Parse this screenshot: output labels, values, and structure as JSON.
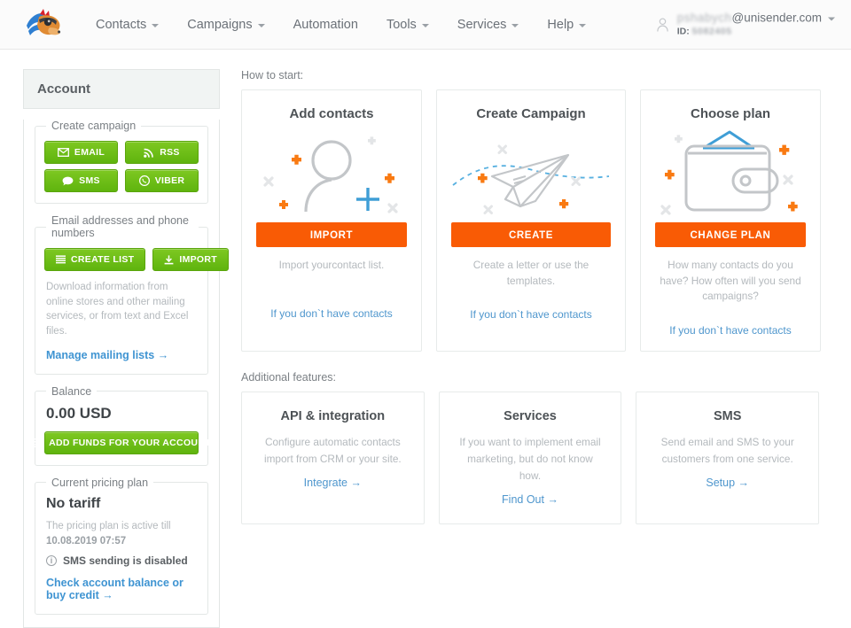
{
  "header": {
    "logo_alt": "unisender-dog-logo",
    "nav": [
      {
        "label": "Contacts",
        "caret": true
      },
      {
        "label": "Campaigns",
        "caret": true
      },
      {
        "label": "Automation",
        "caret": false
      },
      {
        "label": "Tools",
        "caret": true
      },
      {
        "label": "Services",
        "caret": true
      },
      {
        "label": "Help",
        "caret": true
      }
    ],
    "account": {
      "username_redacted": "pshabych",
      "email_domain": "@unisender.com",
      "id_label": "ID:",
      "id_redacted": "5082405"
    }
  },
  "sidebar": {
    "title": "Account",
    "create_campaign": {
      "legend": "Create campaign",
      "buttons": [
        {
          "label": "EMAIL",
          "icon": "envelope-icon"
        },
        {
          "label": "RSS",
          "icon": "rss-icon"
        },
        {
          "label": "SMS",
          "icon": "chat-bubble-icon"
        },
        {
          "label": "VIBER",
          "icon": "viber-icon"
        }
      ]
    },
    "addresses": {
      "legend": "Email addresses and phone numbers",
      "buttons": [
        {
          "label": "CREATE LIST",
          "icon": "list-icon"
        },
        {
          "label": "IMPORT",
          "icon": "download-icon"
        }
      ],
      "hint": "Download information from online stores and other mailing services, or from text and Excel files.",
      "link": "Manage mailing lists  →"
    },
    "balance": {
      "legend": "Balance",
      "value": "0.00 USD",
      "button": "ADD FUNDS FOR YOUR ACCOUNT",
      "button_icon": "credit-card-icon"
    },
    "pricing": {
      "legend": "Current pricing plan",
      "plan_name": "No tariff",
      "note_prefix": "The pricing plan is active till ",
      "note_date": "10.08.2019 07:57",
      "sms_status": "SMS sending is disabled",
      "link": "Check account balance or buy credit →"
    }
  },
  "main": {
    "how_to_start_label": "How to start:",
    "start_cards": [
      {
        "title": "Add contacts",
        "illustration": "person-plus-illustration",
        "button": "IMPORT",
        "desc": "Import yourcontact list.",
        "link": "If you don`t have contacts"
      },
      {
        "title": "Create Campaign",
        "illustration": "paper-plane-illustration",
        "button": "CREATE",
        "desc": "Create a letter or use the templates.",
        "link": "If you don`t have contacts"
      },
      {
        "title": "Choose plan",
        "illustration": "wallet-illustration",
        "button": "CHANGE PLAN",
        "desc": "How many contacts do you have? How often will you send campaigns?",
        "link": "If you don`t have contacts"
      }
    ],
    "additional_label": "Additional features:",
    "feature_cards": [
      {
        "title": "API & integration",
        "desc": "Configure automatic contacts import from CRM or your site.",
        "link": "Integrate  →"
      },
      {
        "title": "Services",
        "desc": "If you want to implement email marketing, but do not know how.",
        "link": "Find Out  →"
      },
      {
        "title": "SMS",
        "desc": "Send email and SMS to your customers from one service.",
        "link": "Setup  →"
      }
    ]
  },
  "colors": {
    "green_button": "#5fb40e",
    "orange_button": "#f95b05",
    "link_blue": "#4e96cd",
    "sidebar_link_blue": "#3f94d2",
    "accent_orange_sparkle": "#f97a12",
    "accent_blue_line": "#3f9ed6"
  }
}
